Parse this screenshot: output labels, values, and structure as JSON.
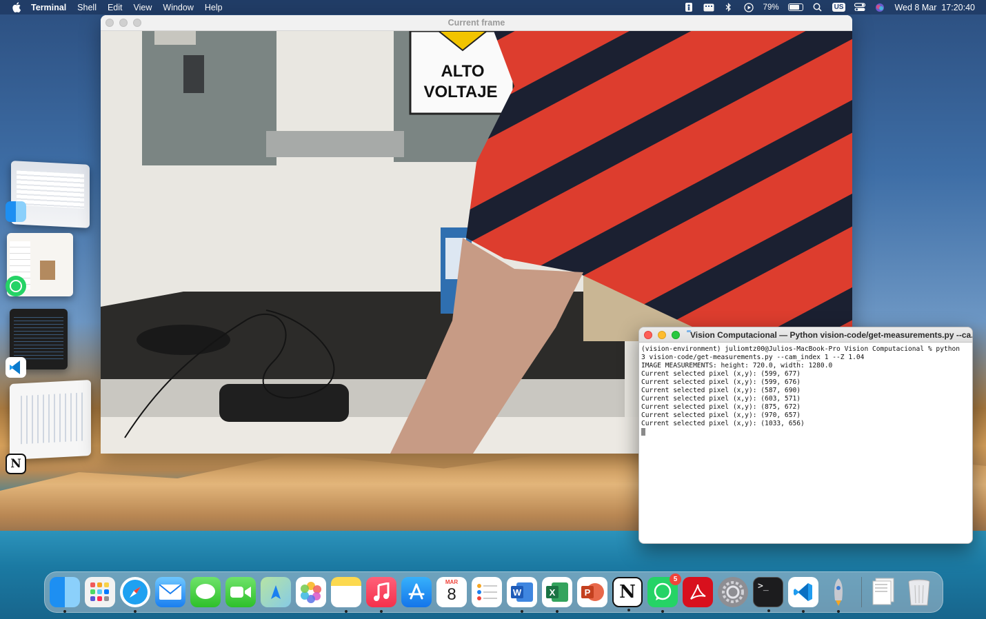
{
  "menubar": {
    "app_name": "Terminal",
    "menus": [
      "Shell",
      "Edit",
      "View",
      "Window",
      "Help"
    ],
    "battery_percent": "79%",
    "battery_level": 0.79,
    "input_source": "US",
    "datetime": "Wed 8 Mar  17:20:40"
  },
  "frame_window": {
    "title": "Current frame",
    "sign_text_1": "ALTO",
    "sign_text_2": "VOLTAJE"
  },
  "terminal": {
    "title": "Vision Computacional — Python vision-code/get-measurements.py --ca...",
    "lines": [
      "(vision-environment) juliomtz00@Julios-MacBook-Pro Vision Computacional % python",
      "3 vision-code/get-measurements.py --cam_index 1 --Z 1.04",
      "IMAGE MEASUREMENTS: height: 720.0, width: 1280.0",
      "Current selected pixel (x,y): (599, 677)",
      "Current selected pixel (x,y): (599, 676)",
      "Current selected pixel (x,y): (587, 690)",
      "Current selected pixel (x,y): (603, 571)",
      "Current selected pixel (x,y): (875, 672)",
      "Current selected pixel (x,y): (970, 657)",
      "Current selected pixel (x,y): (1033, 656)"
    ]
  },
  "dock": {
    "whatsapp_badge": "5",
    "calendar_month": "MAR",
    "calendar_day": "8"
  }
}
